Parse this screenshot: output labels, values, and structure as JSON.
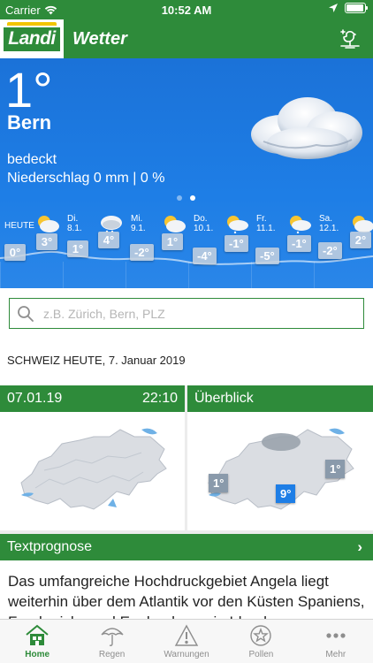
{
  "status_bar": {
    "carrier": "Carrier",
    "time": "10:52 AM"
  },
  "nav": {
    "logo_text": "Landi",
    "title": "Wetter"
  },
  "hero": {
    "temperature": "1°",
    "city": "Bern",
    "condition": "bedeckt",
    "precipitation": "Niederschlag 0 mm | 0 %",
    "page_count": 2,
    "active_page": 2
  },
  "forecast": [
    {
      "day": "HEUTE",
      "date": "",
      "temps": [
        "0°",
        "3°"
      ]
    },
    {
      "day": "Di.",
      "date": "8.1.",
      "temps": [
        "1°",
        "4°"
      ]
    },
    {
      "day": "Mi.",
      "date": "9.1.",
      "temps": [
        "-2°",
        "1°"
      ]
    },
    {
      "day": "Do.",
      "date": "10.1.",
      "temps": [
        "-4°",
        "-1°"
      ]
    },
    {
      "day": "Fr.",
      "date": "11.1.",
      "temps": [
        "-5°",
        "-1°"
      ]
    },
    {
      "day": "Sa.",
      "date": "12.1.",
      "temps": [
        "-2°",
        "2°"
      ]
    }
  ],
  "search": {
    "placeholder": "z.B. Zürich, Bern, PLZ"
  },
  "section": {
    "title": "SCHWEIZ HEUTE, 7. Januar 2019"
  },
  "cards": {
    "radar": {
      "date": "07.01.19",
      "time": "22:10"
    },
    "overview": {
      "title": "Überblick",
      "badges": [
        "1°",
        "9°",
        "1°"
      ]
    }
  },
  "text_forecast": {
    "title": "Textprognose",
    "body": "Das umfangreiche Hochdruckgebiet Angela liegt weiterhin über dem Atlantik vor den Küsten Spaniens, Frankreichs und Englands sowie Irlands."
  },
  "tabs": [
    {
      "label": "Home",
      "icon": "house-icon",
      "active": true
    },
    {
      "label": "Regen",
      "icon": "umbrella-icon",
      "active": false
    },
    {
      "label": "Warnungen",
      "icon": "warning-icon",
      "active": false
    },
    {
      "label": "Pollen",
      "icon": "pollen-icon",
      "active": false
    },
    {
      "label": "Mehr",
      "icon": "more-icon",
      "active": false
    }
  ],
  "colors": {
    "brand_green": "#2e8b3a",
    "sky_blue": "#1e7ee6",
    "logo_yellow": "#f2c500"
  }
}
